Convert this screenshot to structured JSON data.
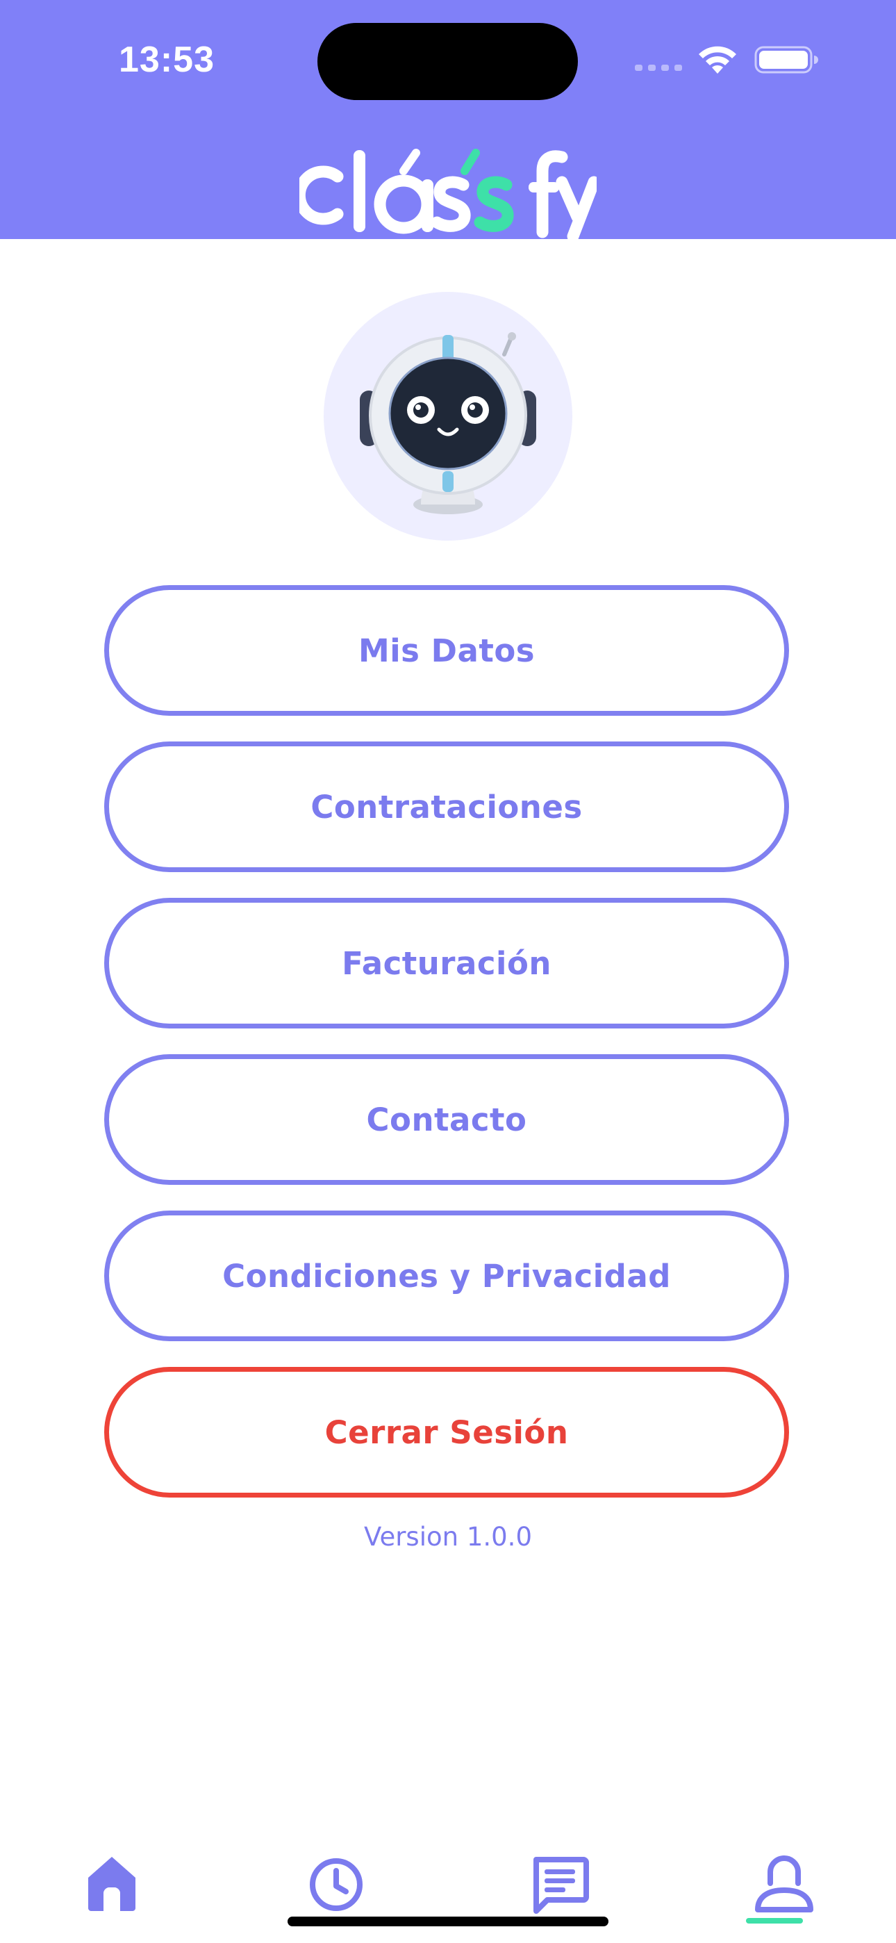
{
  "status_bar": {
    "time": "13:53"
  },
  "header": {
    "brand": "classfy",
    "colors": {
      "background": "#8080f8",
      "logo_white": "#ffffff",
      "logo_accent": "#3ee0a8"
    }
  },
  "menu": {
    "items": [
      {
        "label": "Mis Datos"
      },
      {
        "label": "Contrataciones"
      },
      {
        "label": "Facturación"
      },
      {
        "label": "Contacto"
      },
      {
        "label": "Condiciones y Privacidad"
      }
    ],
    "logout_label": "Cerrar Sesión",
    "colors": {
      "primary": "#8080f0",
      "danger": "#ee4338"
    }
  },
  "version": "Version 1.0.0",
  "tab_bar": {
    "tabs": [
      {
        "icon": "home-icon"
      },
      {
        "icon": "clock-icon"
      },
      {
        "icon": "chat-icon"
      },
      {
        "icon": "user-icon",
        "active": true
      }
    ],
    "colors": {
      "icon": "#7b7bee",
      "active_indicator": "#3ee0a8"
    }
  }
}
